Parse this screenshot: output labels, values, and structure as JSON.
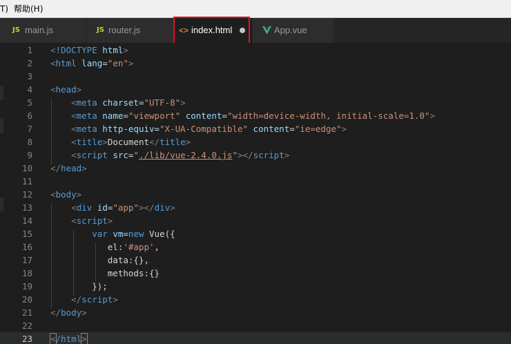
{
  "menubar": {
    "items": [
      "T)",
      "帮助(H)"
    ]
  },
  "tabs": [
    {
      "label": "main.js",
      "icon": "js-file-icon",
      "icon_text": "JS",
      "active": false
    },
    {
      "label": "router.js",
      "icon": "js-file-icon",
      "icon_text": "JS",
      "active": false
    },
    {
      "label": "index.html",
      "icon": "html-file-icon",
      "icon_text": "<>",
      "active": true,
      "unsaved": true
    },
    {
      "label": "App.vue",
      "icon": "vue-file-icon",
      "icon_text": "",
      "active": false
    }
  ],
  "colors": {
    "tag": "#569cd6",
    "attribute": "#9cdcfe",
    "string": "#ce9178",
    "keyword": "#569cd6",
    "text": "#d4d4d4",
    "highlight_box": "#e81123"
  },
  "editor": {
    "current_line": 23,
    "lines": [
      {
        "n": "1",
        "tokens": [
          [
            "b",
            "<"
          ],
          [
            "tag",
            "!DOCTYPE"
          ],
          [
            "x",
            " "
          ],
          [
            "attr",
            "html"
          ],
          [
            "b",
            ">"
          ]
        ]
      },
      {
        "n": "2",
        "tokens": [
          [
            "b",
            "<"
          ],
          [
            "tag",
            "html"
          ],
          [
            "x",
            " "
          ],
          [
            "attr",
            "lang"
          ],
          [
            "x",
            "="
          ],
          [
            "str",
            "\"en\""
          ],
          [
            "b",
            ">"
          ]
        ]
      },
      {
        "n": "3",
        "tokens": []
      },
      {
        "n": "4",
        "tokens": [
          [
            "b",
            "<"
          ],
          [
            "tag",
            "head"
          ],
          [
            "b",
            ">"
          ]
        ]
      },
      {
        "n": "5",
        "tokens": [
          [
            "x",
            "    "
          ],
          [
            "b",
            "<"
          ],
          [
            "tag",
            "meta"
          ],
          [
            "x",
            " "
          ],
          [
            "attr",
            "charset"
          ],
          [
            "x",
            "="
          ],
          [
            "str",
            "\"UTF-8\""
          ],
          [
            "b",
            ">"
          ]
        ]
      },
      {
        "n": "6",
        "tokens": [
          [
            "x",
            "    "
          ],
          [
            "b",
            "<"
          ],
          [
            "tag",
            "meta"
          ],
          [
            "x",
            " "
          ],
          [
            "attr",
            "name"
          ],
          [
            "x",
            "="
          ],
          [
            "str",
            "\"viewport\""
          ],
          [
            "x",
            " "
          ],
          [
            "attr",
            "content"
          ],
          [
            "x",
            "="
          ],
          [
            "str",
            "\"width=device-width, initial-scale=1.0\""
          ],
          [
            "b",
            ">"
          ]
        ]
      },
      {
        "n": "7",
        "tokens": [
          [
            "x",
            "    "
          ],
          [
            "b",
            "<"
          ],
          [
            "tag",
            "meta"
          ],
          [
            "x",
            " "
          ],
          [
            "attr",
            "http-equiv"
          ],
          [
            "x",
            "="
          ],
          [
            "str",
            "\"X-UA-Compatible\""
          ],
          [
            "x",
            " "
          ],
          [
            "attr",
            "content"
          ],
          [
            "x",
            "="
          ],
          [
            "str",
            "\"ie=edge\""
          ],
          [
            "b",
            ">"
          ]
        ]
      },
      {
        "n": "8",
        "tokens": [
          [
            "x",
            "    "
          ],
          [
            "b",
            "<"
          ],
          [
            "tag",
            "title"
          ],
          [
            "b",
            ">"
          ],
          [
            "x",
            "Document"
          ],
          [
            "b",
            "</"
          ],
          [
            "tag",
            "title"
          ],
          [
            "b",
            ">"
          ]
        ]
      },
      {
        "n": "9",
        "tokens": [
          [
            "x",
            "    "
          ],
          [
            "b",
            "<"
          ],
          [
            "tag",
            "script"
          ],
          [
            "x",
            " "
          ],
          [
            "attr",
            "src"
          ],
          [
            "x",
            "="
          ],
          [
            "str",
            "\""
          ],
          [
            "strlink",
            "./lib/vue-2.4.0.js"
          ],
          [
            "str",
            "\""
          ],
          [
            "b",
            ">"
          ],
          [
            "b",
            "</"
          ],
          [
            "tag",
            "script"
          ],
          [
            "b",
            ">"
          ]
        ]
      },
      {
        "n": "10",
        "tokens": [
          [
            "b",
            "</"
          ],
          [
            "tag",
            "head"
          ],
          [
            "b",
            ">"
          ]
        ]
      },
      {
        "n": "11",
        "tokens": []
      },
      {
        "n": "12",
        "tokens": [
          [
            "b",
            "<"
          ],
          [
            "tag",
            "body"
          ],
          [
            "b",
            ">"
          ]
        ]
      },
      {
        "n": "13",
        "tokens": [
          [
            "x",
            "    "
          ],
          [
            "b",
            "<"
          ],
          [
            "tag",
            "div"
          ],
          [
            "x",
            " "
          ],
          [
            "attr",
            "id"
          ],
          [
            "x",
            "="
          ],
          [
            "str",
            "\"app\""
          ],
          [
            "b",
            ">"
          ],
          [
            "b",
            "</"
          ],
          [
            "tag",
            "div"
          ],
          [
            "b",
            ">"
          ]
        ]
      },
      {
        "n": "14",
        "tokens": [
          [
            "x",
            "    "
          ],
          [
            "b",
            "<"
          ],
          [
            "tag",
            "script"
          ],
          [
            "b",
            ">"
          ]
        ]
      },
      {
        "n": "15",
        "tokens": [
          [
            "x",
            "        "
          ],
          [
            "kw",
            "var"
          ],
          [
            "x",
            " "
          ],
          [
            "attr",
            "vm"
          ],
          [
            "x",
            "="
          ],
          [
            "kw",
            "new"
          ],
          [
            "x",
            " "
          ],
          [
            "x",
            "Vue({"
          ]
        ]
      },
      {
        "n": "16",
        "tokens": [
          [
            "x",
            "           el:"
          ],
          [
            "str",
            "'#app'"
          ],
          [
            "x",
            ","
          ]
        ]
      },
      {
        "n": "17",
        "tokens": [
          [
            "x",
            "           data:{},"
          ]
        ]
      },
      {
        "n": "18",
        "tokens": [
          [
            "x",
            "           methods:{}"
          ]
        ]
      },
      {
        "n": "19",
        "tokens": [
          [
            "x",
            "        });"
          ]
        ]
      },
      {
        "n": "20",
        "tokens": [
          [
            "x",
            "    "
          ],
          [
            "b",
            "</"
          ],
          [
            "tag",
            "script"
          ],
          [
            "b",
            ">"
          ]
        ]
      },
      {
        "n": "21",
        "tokens": [
          [
            "b",
            "</"
          ],
          [
            "tag",
            "body"
          ],
          [
            "b",
            ">"
          ]
        ]
      },
      {
        "n": "22",
        "tokens": []
      },
      {
        "n": "23",
        "tokens": [
          [
            "bm",
            "<"
          ],
          [
            "b",
            "/"
          ],
          [
            "tag",
            "html"
          ],
          [
            "bm",
            ">"
          ]
        ]
      }
    ]
  }
}
